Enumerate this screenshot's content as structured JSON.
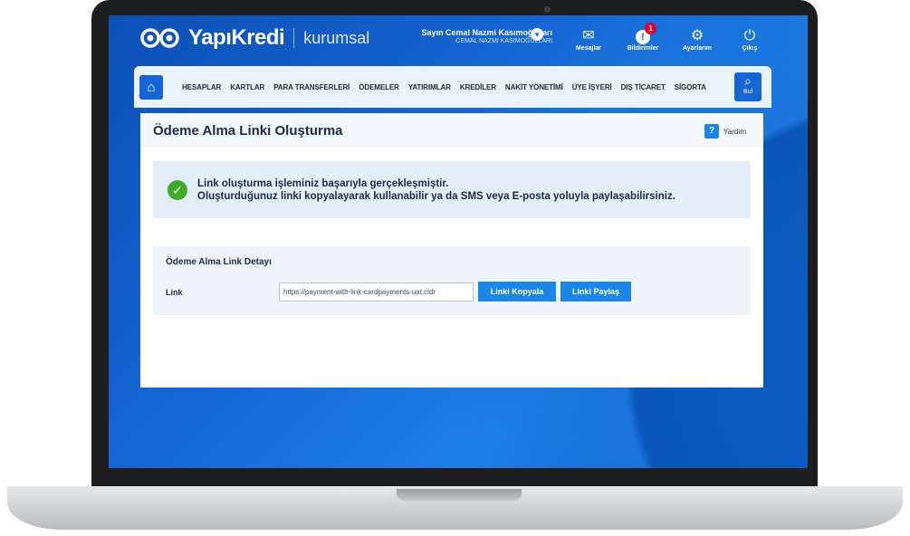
{
  "header": {
    "brand": "YapıKredi",
    "brand_sub": "kurumsal",
    "user_name": "Sayın Cemal Nazmi Kasımoğulları",
    "user_company": "CEMAL NAZMİ KASIMOĞULLARI",
    "icons": [
      {
        "name": "mail-icon",
        "label": "Mesajlar",
        "glyph": "✉"
      },
      {
        "name": "notification-icon",
        "label": "Bildirimler",
        "glyph": "!",
        "badge": "1"
      },
      {
        "name": "gear-icon",
        "label": "Ayarlarım",
        "glyph": "⚙"
      },
      {
        "name": "power-icon",
        "label": "Çıkış",
        "glyph": "⏻"
      }
    ]
  },
  "nav": {
    "items": [
      "HESAPLAR",
      "KARTLAR",
      "PARA TRANSFERLERİ",
      "ÖDEMELER",
      "YATIRIMLAR",
      "KREDİLER",
      "NAKİT YÖNETİMİ",
      "ÜYE İŞYERİ",
      "DIŞ TİCARET",
      "SİGORTA"
    ],
    "search_label": "Bul"
  },
  "page": {
    "title": "Ödeme Alma Linki Oluşturma",
    "help_label": "Yardım",
    "success_line1": "Link oluşturma işleminiz başarıyla gerçekleşmiştir.",
    "success_line2": "Oluşturduğunuz linki kopyalayarak kullanabilir ya da SMS veya E-posta yoluyla paylaşabilirsiniz.",
    "detail_title": "Ödeme Alma Link Detayı",
    "link_label": "Link",
    "link_value": "https://payment-with-link-cardpayments-uat.cldr",
    "copy_button": "Linki Kopyala",
    "share_button": "Linki Paylaş"
  },
  "colors": {
    "accent": "#1b86e8",
    "success": "#41a92a",
    "badge": "#e4002b"
  }
}
